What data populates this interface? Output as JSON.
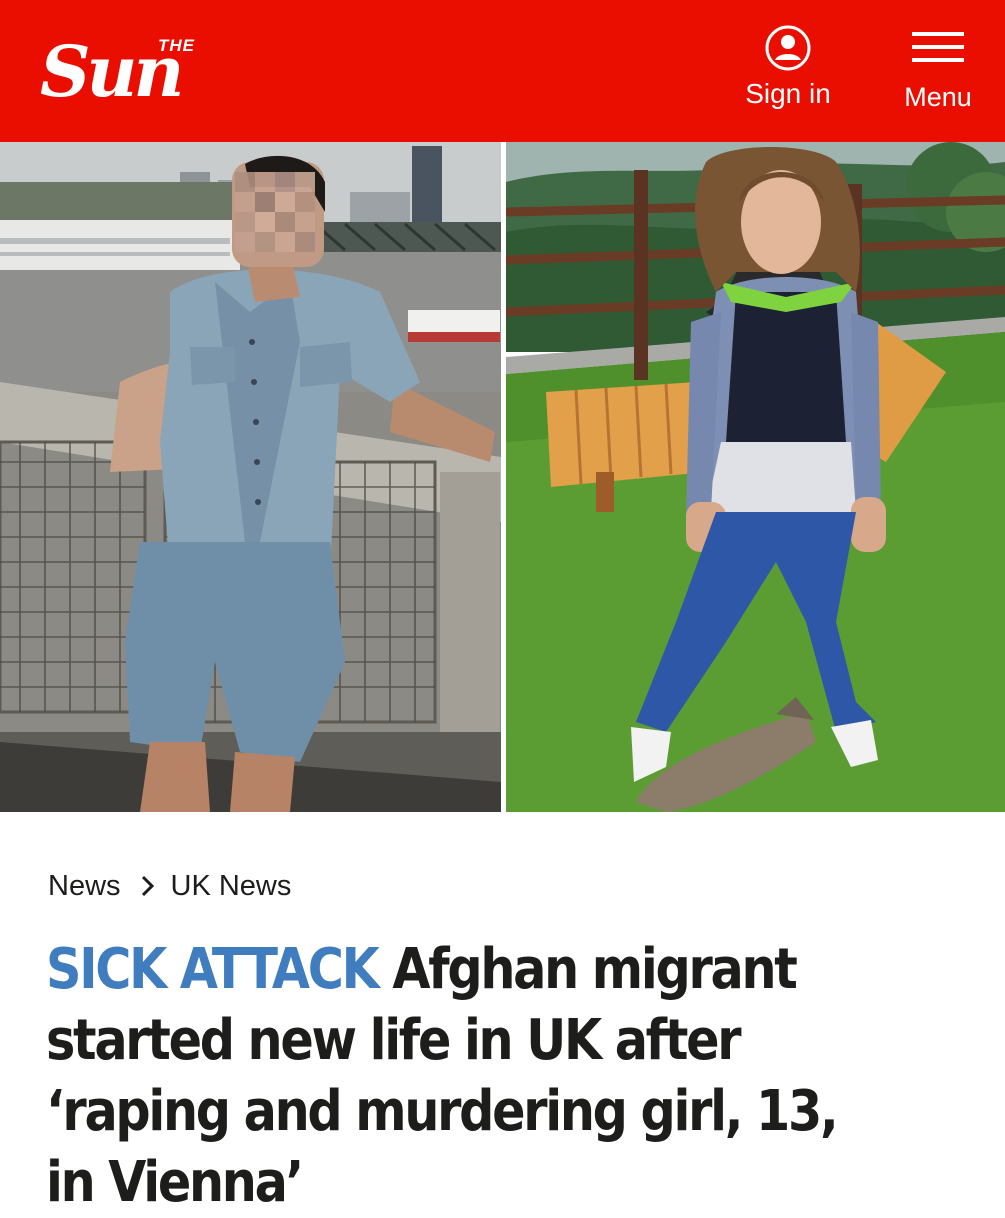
{
  "header": {
    "logo_small": "THE",
    "logo_main": "Sun",
    "sign_in_label": "Sign in",
    "menu_label": "Menu",
    "brand_color": "#e90e00"
  },
  "images": {
    "left": "man-by-river-railing-photo",
    "right": "girl-on-grass-with-cat-photo"
  },
  "breadcrumb": {
    "items": [
      "News",
      "UK News"
    ],
    "separator_icon": "chevron-right-icon"
  },
  "article": {
    "kicker": "SICK ATTACK",
    "headline": "Afghan migrant started new life in UK after ‘raping and murdering girl, 13, in Vienna’",
    "kicker_color": "#3f7dbf"
  }
}
